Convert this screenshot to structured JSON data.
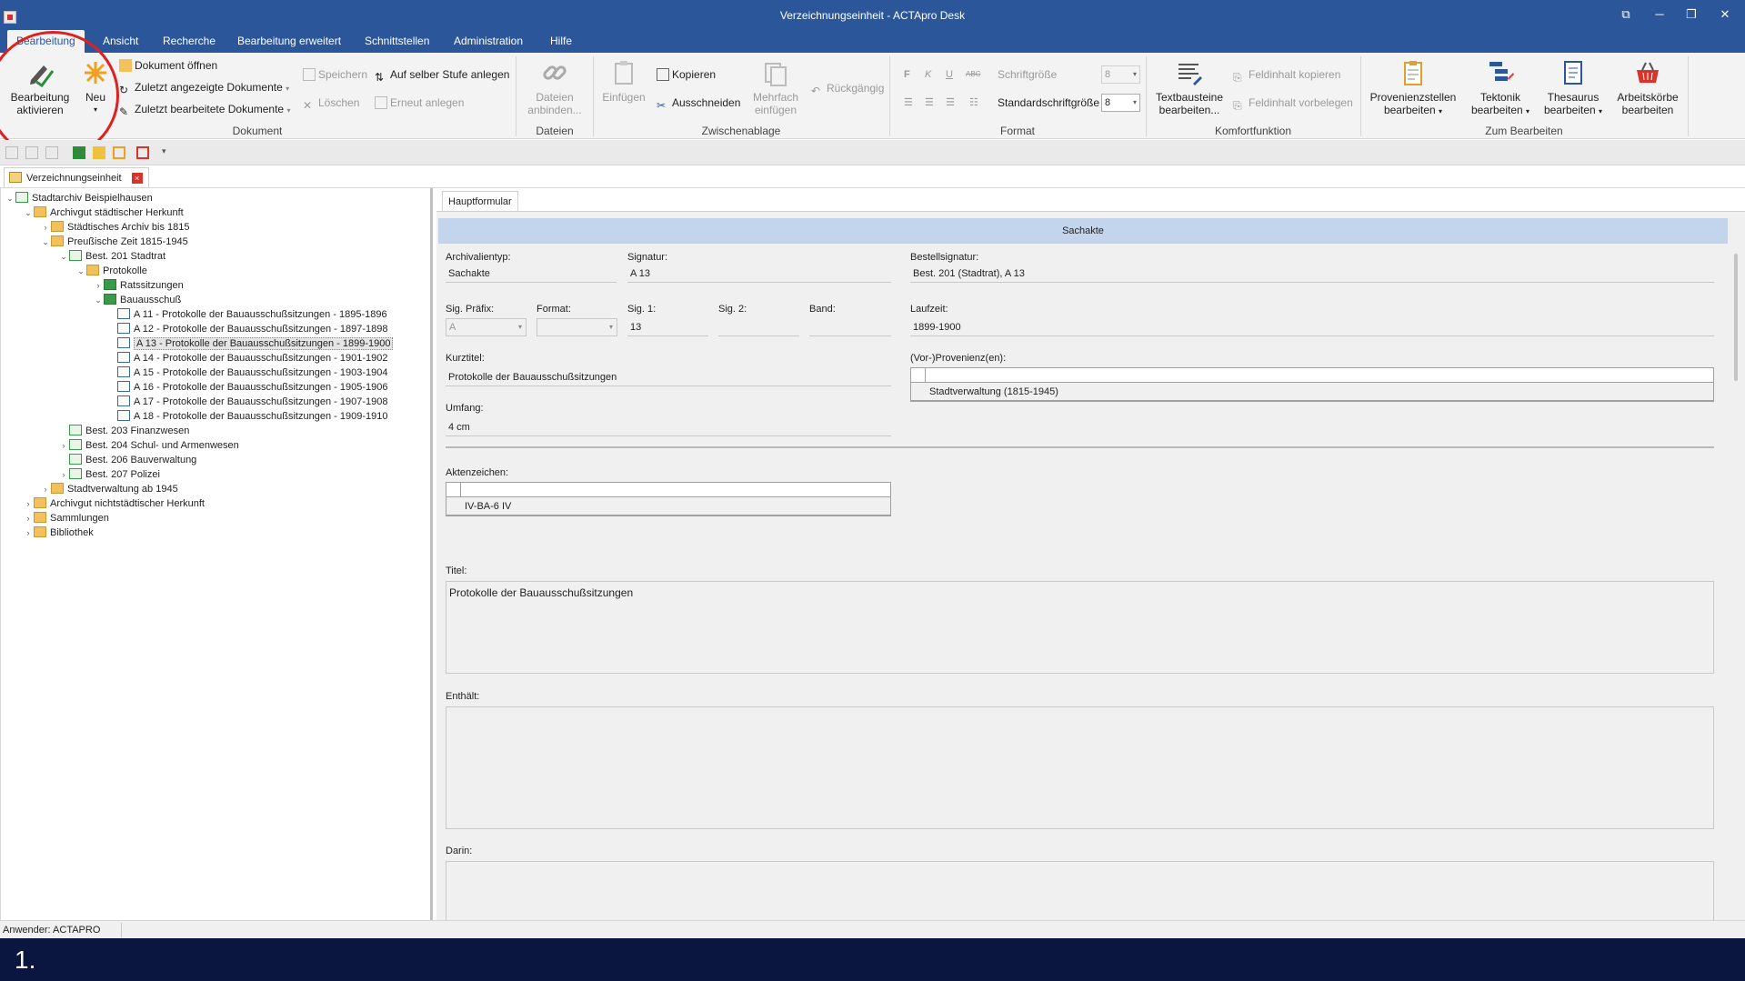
{
  "window": {
    "title": "Verzeichnungseinheit - ACTApro Desk",
    "controls": [
      "⧉",
      "─",
      "❐",
      "✕"
    ]
  },
  "menu_tabs": [
    "Bearbeitung",
    "Ansicht",
    "Recherche",
    "Bearbeitung erweitert",
    "Schnittstellen",
    "Administration",
    "Hilfe"
  ],
  "ribbon": {
    "dokument": {
      "label": "Dokument",
      "bearbeitung_aktivieren": "Bearbeitung aktivieren",
      "neu": "Neu",
      "dokument_oeffnen": "Dokument öffnen",
      "zuletzt_angezeigt": "Zuletzt angezeigte Dokumente",
      "zuletzt_bearbeitet": "Zuletzt bearbeitete Dokumente",
      "speichern": "Speichern",
      "loeschen": "Löschen",
      "auf_selber_stufe": "Auf selber Stufe anlegen",
      "erneut_anlegen": "Erneut anlegen"
    },
    "dateien": {
      "label": "Dateien",
      "dateien_anbinden": "Dateien anbinden..."
    },
    "zwischenablage": {
      "label": "Zwischenablage",
      "einfuegen": "Einfügen",
      "kopieren": "Kopieren",
      "ausschneiden": "Ausschneiden",
      "mehrfach_einfuegen": "Mehrfach einfügen",
      "rueckgaengig": "Rückgängig"
    },
    "format": {
      "label": "Format",
      "schriftgroesse": "Schriftgröße",
      "schriftgroesse_value": "8",
      "standardschriftgroesse": "Standardschriftgröße",
      "standardschriftgroesse_value": "8",
      "bold": "F",
      "italic": "K",
      "underline": "U",
      "strike": "ABC"
    },
    "komfortfunktion": {
      "label": "Komfortfunktion",
      "textbausteine": "Textbausteine bearbeiten...",
      "feldinhalt_kopieren": "Feldinhalt kopieren",
      "feldinhalt_vorbelegen": "Feldinhalt vorbelegen"
    },
    "zum_bearbeiten": {
      "label": "Zum Bearbeiten",
      "provenienzstellen": "Provenienzstellen bearbeiten",
      "tektonik": "Tektonik bearbeiten",
      "thesaurus": "Thesaurus bearbeiten",
      "arbeitskoerbe": "Arbeitskörbe bearbeiten"
    }
  },
  "doc_tab": {
    "label": "Verzeichnungseinheit",
    "close": "×"
  },
  "tree": {
    "nodes": [
      {
        "label": "Stadtarchiv Beispielhausen",
        "exp": "⌄",
        "icon": "best"
      },
      {
        "label": "Archivgut städtischer Herkunft",
        "exp": "⌄",
        "icon": "folder"
      },
      {
        "label": "Städtisches Archiv bis 1815",
        "exp": "›",
        "icon": "folder"
      },
      {
        "label": "Preußische Zeit 1815-1945",
        "exp": "⌄",
        "icon": "folder"
      },
      {
        "label": "Best. 201 Stadtrat",
        "exp": "⌄",
        "icon": "best"
      },
      {
        "label": "Protokolle",
        "exp": "⌄",
        "icon": "folder"
      },
      {
        "label": "Ratssitzungen",
        "exp": "›",
        "icon": "class"
      },
      {
        "label": "Bauausschuß",
        "exp": "⌄",
        "icon": "class"
      },
      {
        "label": "A 11 - Protokolle der Bauausschußsitzungen - 1895-1896",
        "exp": "",
        "icon": "doc"
      },
      {
        "label": "A 12 - Protokolle der Bauausschußsitzungen - 1897-1898",
        "exp": "",
        "icon": "doc"
      },
      {
        "label": "A 13 - Protokolle der Bauausschußsitzungen - 1899-1900",
        "exp": "",
        "icon": "doc"
      },
      {
        "label": "A 14 - Protokolle der Bauausschußsitzungen - 1901-1902",
        "exp": "",
        "icon": "doc"
      },
      {
        "label": "A 15 - Protokolle der Bauausschußsitzungen - 1903-1904",
        "exp": "",
        "icon": "doc"
      },
      {
        "label": "A 16 - Protokolle der Bauausschußsitzungen - 1905-1906",
        "exp": "",
        "icon": "doc"
      },
      {
        "label": "A 17 - Protokolle der Bauausschußsitzungen - 1907-1908",
        "exp": "",
        "icon": "doc"
      },
      {
        "label": "A 18 - Protokolle der Bauausschußsitzungen - 1909-1910",
        "exp": "",
        "icon": "doc"
      },
      {
        "label": "Best. 203 Finanzwesen",
        "exp": "",
        "icon": "best"
      },
      {
        "label": "Best. 204 Schul- und Armenwesen",
        "exp": "›",
        "icon": "best"
      },
      {
        "label": "Best. 206 Bauverwaltung",
        "exp": "",
        "icon": "best"
      },
      {
        "label": "Best. 207 Polizei",
        "exp": "›",
        "icon": "best"
      },
      {
        "label": "Stadtverwaltung ab 1945",
        "exp": "›",
        "icon": "folder"
      },
      {
        "label": "Archivgut nichtstädtischer Herkunft",
        "exp": "›",
        "icon": "folder"
      },
      {
        "label": "Sammlungen",
        "exp": "›",
        "icon": "folder"
      },
      {
        "label": "Bibliothek",
        "exp": "›",
        "icon": "folder"
      }
    ],
    "selected_label": "A 13 - Protokolle der Bauausschußsitzungen - 1899-1900"
  },
  "form": {
    "tab": "Hauptformular",
    "header": "Sachakte",
    "archivalientyp_label": "Archivalientyp:",
    "archivalientyp": "Sachakte",
    "signatur_label": "Signatur:",
    "signatur": "A 13",
    "bestellsignatur_label": "Bestellsignatur:",
    "bestellsignatur": "Best. 201 (Stadtrat), A 13",
    "sig_praefix_label": "Sig. Präfix:",
    "sig_praefix": "A",
    "format_label": "Format:",
    "format": "",
    "sig1_label": "Sig. 1:",
    "sig1": "13",
    "sig2_label": "Sig. 2:",
    "sig2": "",
    "band_label": "Band:",
    "band": "",
    "laufzeit_label": "Laufzeit:",
    "laufzeit": "1899-1900",
    "kurztitel_label": "Kurztitel:",
    "kurztitel": "Protokolle der Bauausschußsitzungen",
    "provenienz_label": "(Vor-)Provenienz(en):",
    "provenienz": "Stadtverwaltung (1815-1945)",
    "umfang_label": "Umfang:",
    "umfang": "4 cm",
    "aktenzeichen_label": "Aktenzeichen:",
    "aktenzeichen": "IV-BA-6 IV",
    "titel_label": "Titel:",
    "titel": "Protokolle der Bauausschußsitzungen",
    "enthaelt_label": "Enthält:",
    "darin_label": "Darin:"
  },
  "status": {
    "anwender": "Anwender: ACTAPRO"
  },
  "caption": "1.",
  "colors": {
    "titlebar": "#2b579a",
    "annotation": "#e02020",
    "form_header": "#c2d5ec",
    "caption_bg": "#0b1640"
  }
}
